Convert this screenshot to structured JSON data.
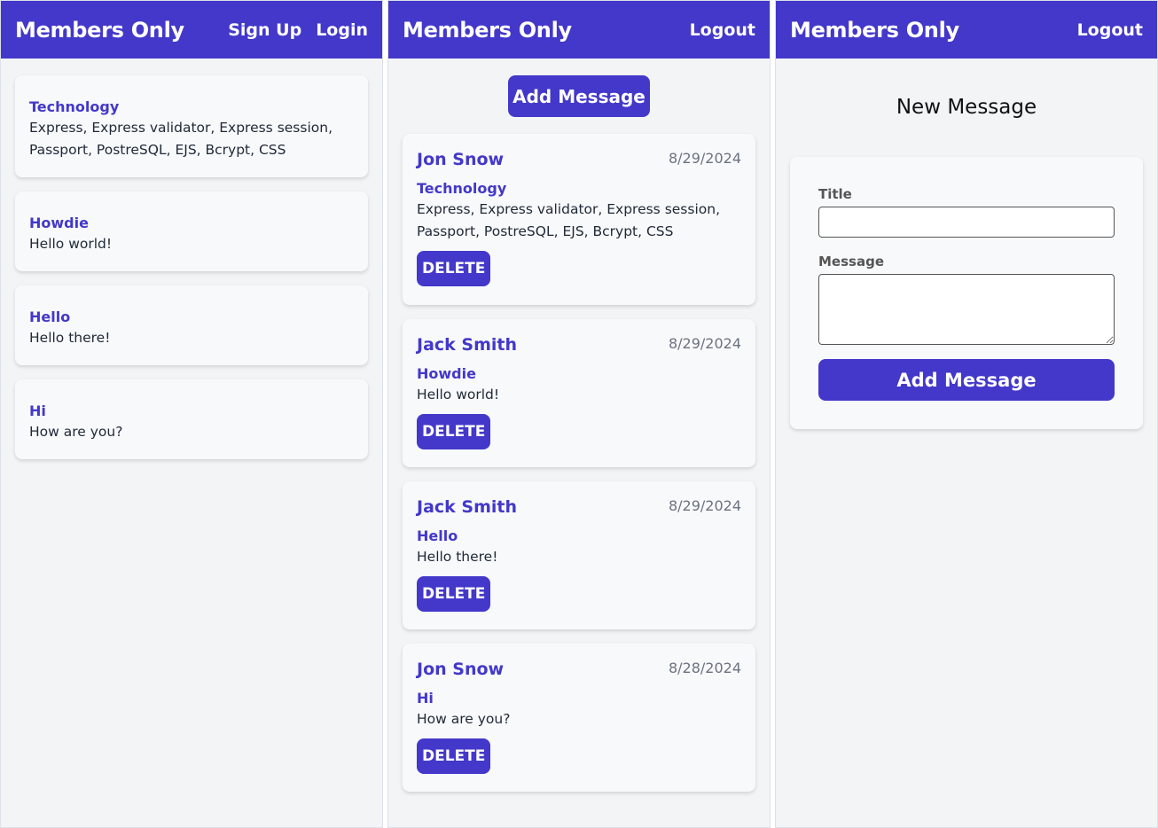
{
  "app_title": "Members Only",
  "panel1": {
    "nav": {
      "signup": "Sign Up",
      "login": "Login"
    },
    "messages": [
      {
        "title": "Technology",
        "text": "Express, Express validator, Express session, Passport, PostreSQL, EJS, Bcrypt, CSS"
      },
      {
        "title": "Howdie",
        "text": "Hello world!"
      },
      {
        "title": "Hello",
        "text": "Hello there!"
      },
      {
        "title": "Hi",
        "text": "How are you?"
      }
    ]
  },
  "panel2": {
    "nav": {
      "logout": "Logout"
    },
    "add_button": "Add Message",
    "delete_label": "DELETE",
    "messages": [
      {
        "author": "Jon Snow",
        "date": "8/29/2024",
        "title": "Technology",
        "text": "Express, Express validator, Express session, Passport, PostreSQL, EJS, Bcrypt, CSS"
      },
      {
        "author": "Jack Smith",
        "date": "8/29/2024",
        "title": "Howdie",
        "text": "Hello world!"
      },
      {
        "author": "Jack Smith",
        "date": "8/29/2024",
        "title": "Hello",
        "text": "Hello there!"
      },
      {
        "author": "Jon Snow",
        "date": "8/28/2024",
        "title": "Hi",
        "text": "How are you?"
      }
    ]
  },
  "panel3": {
    "nav": {
      "logout": "Logout"
    },
    "heading": "New Message",
    "form": {
      "title_label": "Title",
      "title_value": "",
      "message_label": "Message",
      "message_value": "",
      "submit_label": "Add Message"
    }
  },
  "colors": {
    "accent": "#4338ca",
    "background": "#f3f4f6",
    "card": "#f8f9fb"
  }
}
